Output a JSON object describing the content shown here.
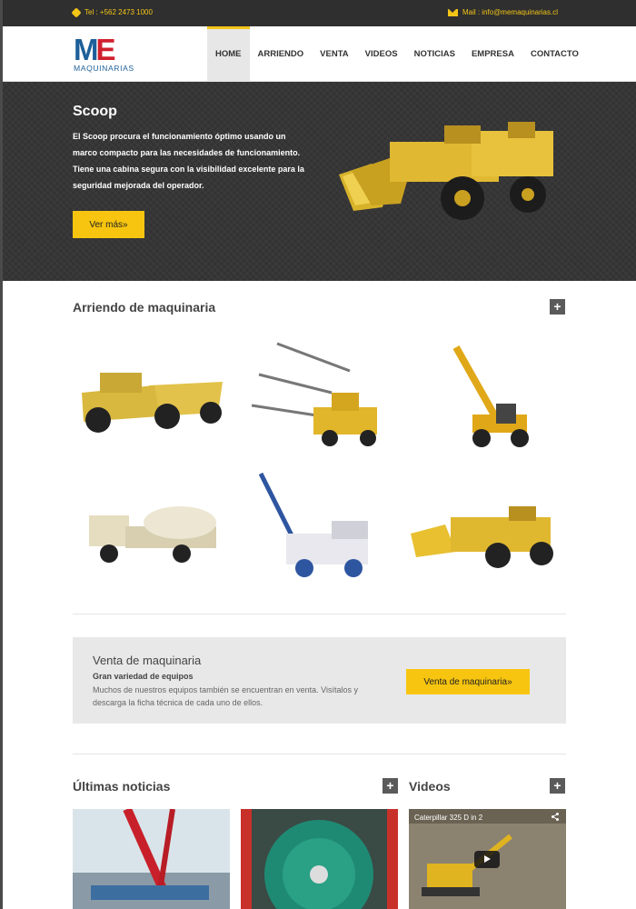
{
  "topbar": {
    "tel": "Tel : +562 2473 1000",
    "mail": "Mail : info@memaquinarias.cl"
  },
  "logo": {
    "mark_m": "M",
    "mark_e": "E",
    "text": "MAQUINARIAS"
  },
  "nav": {
    "items": [
      "HOME",
      "ARRIENDO",
      "VENTA",
      "VIDEOS",
      "NOTICIAS",
      "EMPRESA",
      "CONTACTO"
    ],
    "active": "HOME"
  },
  "hero": {
    "title": "Scoop",
    "text": "El Scoop procura el funcionamiento óptimo usando un marco compacto para las necesidades de funcionamiento. Tiene una cabina segura con la visibilidad excelente para la seguridad mejorada del operador.",
    "button": "Ver más»"
  },
  "arriendo": {
    "title": "Arriendo de maquinaria",
    "plus": "+"
  },
  "venta": {
    "title": "Venta de maquinaria",
    "subtitle": "Gran variedad de equipos",
    "text": "Muchos de nuestros equipos también se encuentran en venta. Visítalos y descarga la ficha técnica de cada uno de ellos.",
    "button": "Venta de maquinaria»"
  },
  "noticias": {
    "title": "Últimas noticias",
    "plus": "+"
  },
  "videos": {
    "title": "Videos",
    "plus": "+",
    "video_title": "Caterpillar 325 D in 2"
  },
  "colors": {
    "accent": "#f7c50f",
    "dark": "#363636",
    "brand_blue": "#1d5f9a",
    "brand_red": "#d0202e"
  }
}
